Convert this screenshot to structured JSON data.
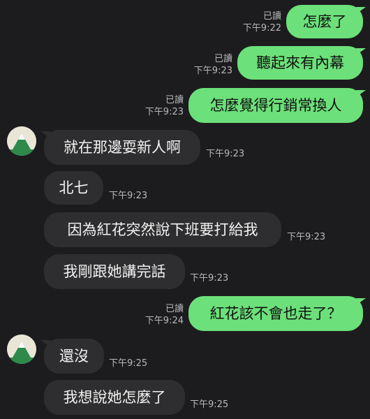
{
  "messages": [
    {
      "text": "怎麼了",
      "read": "已讀",
      "time": "下午9:22"
    },
    {
      "text": "聽起來有內幕",
      "read": "已讀",
      "time": "下午9:23"
    },
    {
      "text": "怎麼覺得行銷常換人",
      "read": "已讀",
      "time": "下午9:23"
    },
    {
      "text": "就在那邊耍新人啊",
      "time": "下午9:23"
    },
    {
      "text": "北七",
      "time": "下午9:23"
    },
    {
      "text": "因為紅花突然說下班要打給我",
      "time": "下午9:23"
    },
    {
      "text": "我剛跟她講完話",
      "time": "下午9:23"
    },
    {
      "text": "紅花該不會也走了？",
      "read": "已讀",
      "time": "下午9:24"
    },
    {
      "text": "還沒",
      "time": "下午9:25"
    },
    {
      "text": "我想說她怎麼了",
      "time": "下午9:25"
    }
  ],
  "colors": {
    "background": "#1c1c1e",
    "outgoing_bubble": "#6ce07a",
    "incoming_bubble": "#2e2e30",
    "meta_text": "#b9b9bb"
  },
  "icons": {
    "contact_avatar": "mountain-avatar-icon"
  }
}
